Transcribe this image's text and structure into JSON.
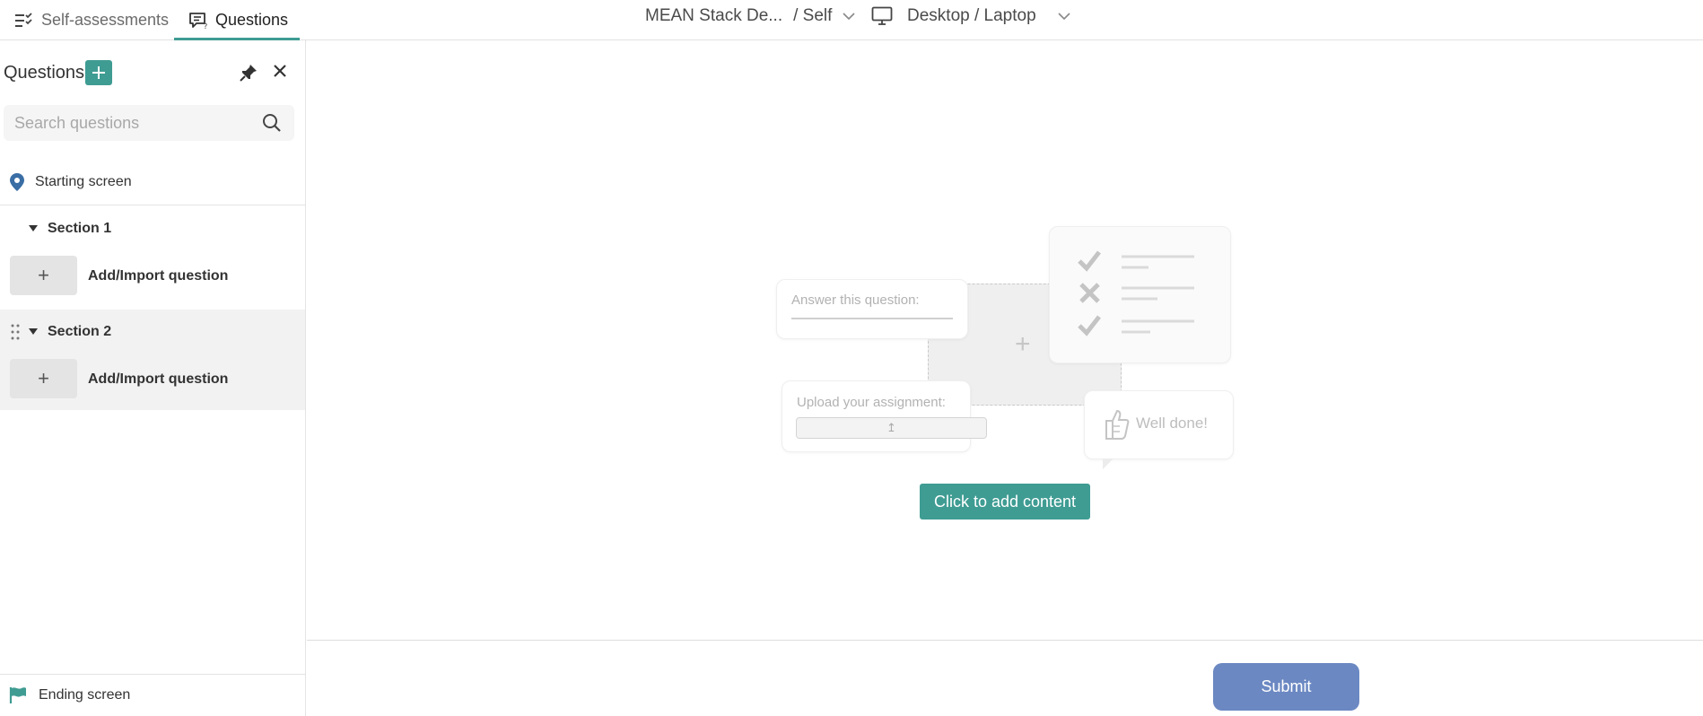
{
  "topbar": {
    "tabs": [
      {
        "label": "Self-assessments",
        "icon": "list-check-icon",
        "active": false
      },
      {
        "label": "Questions",
        "icon": "chat-question-icon",
        "active": true
      }
    ],
    "course_selector": {
      "label": "MEAN Stack De...",
      "suffix": "/ Self",
      "icon": "chevron-down-icon"
    },
    "device_selector": {
      "label": "Desktop / Laptop",
      "icon": "monitor-icon"
    }
  },
  "sidebar": {
    "title": "Questions",
    "search": {
      "placeholder": "Search questions",
      "value": ""
    },
    "starting_screen": {
      "label": "Starting screen",
      "icon": "map-pin-icon"
    },
    "sections": [
      {
        "name": "Section 1",
        "add_label": "Add/Import question",
        "add_symbol": "+"
      },
      {
        "name": "Section 2",
        "add_label": "Add/Import question",
        "add_symbol": "+"
      }
    ],
    "ending_screen": {
      "label": "Ending screen",
      "icon": "flag-icon"
    }
  },
  "main": {
    "illustration": {
      "answer_prompt": "Answer this question:",
      "upload_prompt": "Upload your assignment:",
      "upload_symbol": "↥",
      "praise": "Well done!",
      "center_symbol": "+"
    },
    "cta_label": "Click to add content"
  },
  "footer": {
    "submit_label": "Submit"
  },
  "colors": {
    "accent": "#3f9c93",
    "submit": "#6b88c2",
    "pin": "#3a6ea5"
  }
}
